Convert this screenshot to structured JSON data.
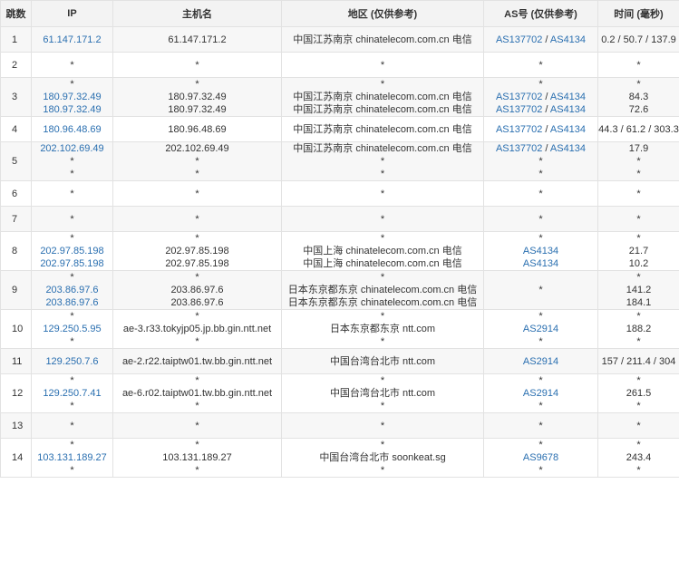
{
  "headers": {
    "hop": "跳数",
    "ip": "IP",
    "host": "主机名",
    "region": "地区 (仅供参考)",
    "as": "AS号 (仅供参考)",
    "time": "时间 (毫秒)"
  },
  "as_separator": " / ",
  "colors": {
    "link": "#2a6fb0",
    "text": "#333333",
    "header_bg": "#f3f3f3",
    "row_alt_bg": "#f7f7f7",
    "border": "#e2e2e2"
  },
  "rows": [
    {
      "hop": "1",
      "ip": [
        "61.147.171.2"
      ],
      "host": [
        "61.147.171.2"
      ],
      "region": [
        "中国江苏南京 chinatelecom.com.cn 电信"
      ],
      "as": [
        [
          "AS137702",
          "AS4134"
        ]
      ],
      "time": [
        "0.2 / 50.7 / 137.9"
      ]
    },
    {
      "hop": "2",
      "ip": [
        "*"
      ],
      "host": [
        "*"
      ],
      "region": [
        "*"
      ],
      "as": [
        [
          "*"
        ]
      ],
      "time": [
        "*"
      ]
    },
    {
      "hop": "3",
      "ip": [
        "*",
        "180.97.32.49",
        "180.97.32.49"
      ],
      "host": [
        "*",
        "180.97.32.49",
        "180.97.32.49"
      ],
      "region": [
        "*",
        "中国江苏南京 chinatelecom.com.cn 电信",
        "中国江苏南京 chinatelecom.com.cn 电信"
      ],
      "as": [
        [
          "*"
        ],
        [
          "AS137702",
          "AS4134"
        ],
        [
          "AS137702",
          "AS4134"
        ]
      ],
      "time": [
        "*",
        "84.3",
        "72.6"
      ]
    },
    {
      "hop": "4",
      "ip": [
        "180.96.48.69"
      ],
      "host": [
        "180.96.48.69"
      ],
      "region": [
        "中国江苏南京 chinatelecom.com.cn 电信"
      ],
      "as": [
        [
          "AS137702",
          "AS4134"
        ]
      ],
      "time": [
        "44.3 / 61.2 / 303.3"
      ]
    },
    {
      "hop": "5",
      "ip": [
        "202.102.69.49",
        "*",
        "*"
      ],
      "host": [
        "202.102.69.49",
        "*",
        "*"
      ],
      "region": [
        "中国江苏南京 chinatelecom.com.cn 电信",
        "*",
        "*"
      ],
      "as": [
        [
          "AS137702",
          "AS4134"
        ],
        [
          "*"
        ],
        [
          "*"
        ]
      ],
      "time": [
        "17.9",
        "*",
        "*"
      ]
    },
    {
      "hop": "6",
      "ip": [
        "*"
      ],
      "host": [
        "*"
      ],
      "region": [
        "*"
      ],
      "as": [
        [
          "*"
        ]
      ],
      "time": [
        "*"
      ]
    },
    {
      "hop": "7",
      "ip": [
        "*"
      ],
      "host": [
        "*"
      ],
      "region": [
        "*"
      ],
      "as": [
        [
          "*"
        ]
      ],
      "time": [
        "*"
      ]
    },
    {
      "hop": "8",
      "ip": [
        "*",
        "202.97.85.198",
        "202.97.85.198"
      ],
      "host": [
        "*",
        "202.97.85.198",
        "202.97.85.198"
      ],
      "region": [
        "*",
        "中国上海 chinatelecom.com.cn 电信",
        "中国上海 chinatelecom.com.cn 电信"
      ],
      "as": [
        [
          "*"
        ],
        [
          "AS4134"
        ],
        [
          "AS4134"
        ]
      ],
      "time": [
        "*",
        "21.7",
        "10.2"
      ]
    },
    {
      "hop": "9",
      "ip": [
        "*",
        "203.86.97.6",
        "203.86.97.6"
      ],
      "host": [
        "*",
        "203.86.97.6",
        "203.86.97.6"
      ],
      "region": [
        "*",
        "日本东京都东京 chinatelecom.com.cn 电信",
        "日本东京都东京 chinatelecom.com.cn 电信"
      ],
      "as": [
        [
          "*"
        ]
      ],
      "time": [
        "*",
        "141.2",
        "184.1"
      ]
    },
    {
      "hop": "10",
      "ip": [
        "*",
        "129.250.5.95",
        "*"
      ],
      "host": [
        "*",
        "ae-3.r33.tokyjp05.jp.bb.gin.ntt.net",
        "*"
      ],
      "region": [
        "*",
        "日本东京都东京 ntt.com",
        "*"
      ],
      "as": [
        [
          "*"
        ],
        [
          "AS2914"
        ],
        [
          "*"
        ]
      ],
      "time": [
        "*",
        "188.2",
        "*"
      ]
    },
    {
      "hop": "11",
      "ip": [
        "129.250.7.6"
      ],
      "host": [
        "ae-2.r22.taiptw01.tw.bb.gin.ntt.net"
      ],
      "region": [
        "中国台湾台北市 ntt.com"
      ],
      "as": [
        [
          "AS2914"
        ]
      ],
      "time": [
        "157 / 211.4 / 304"
      ]
    },
    {
      "hop": "12",
      "ip": [
        "*",
        "129.250.7.41",
        "*"
      ],
      "host": [
        "*",
        "ae-6.r02.taiptw01.tw.bb.gin.ntt.net",
        "*"
      ],
      "region": [
        "*",
        "中国台湾台北市 ntt.com",
        "*"
      ],
      "as": [
        [
          "*"
        ],
        [
          "AS2914"
        ],
        [
          "*"
        ]
      ],
      "time": [
        "*",
        "261.5",
        "*"
      ]
    },
    {
      "hop": "13",
      "ip": [
        "*"
      ],
      "host": [
        "*"
      ],
      "region": [
        "*"
      ],
      "as": [
        [
          "*"
        ]
      ],
      "time": [
        "*"
      ]
    },
    {
      "hop": "14",
      "ip": [
        "*",
        "103.131.189.27",
        "*"
      ],
      "host": [
        "*",
        "103.131.189.27",
        "*"
      ],
      "region": [
        "*",
        "中国台湾台北市 soonkeat.sg",
        "*"
      ],
      "as": [
        [
          "*"
        ],
        [
          "AS9678"
        ],
        [
          "*"
        ]
      ],
      "time": [
        "*",
        "243.4",
        "*"
      ]
    }
  ]
}
